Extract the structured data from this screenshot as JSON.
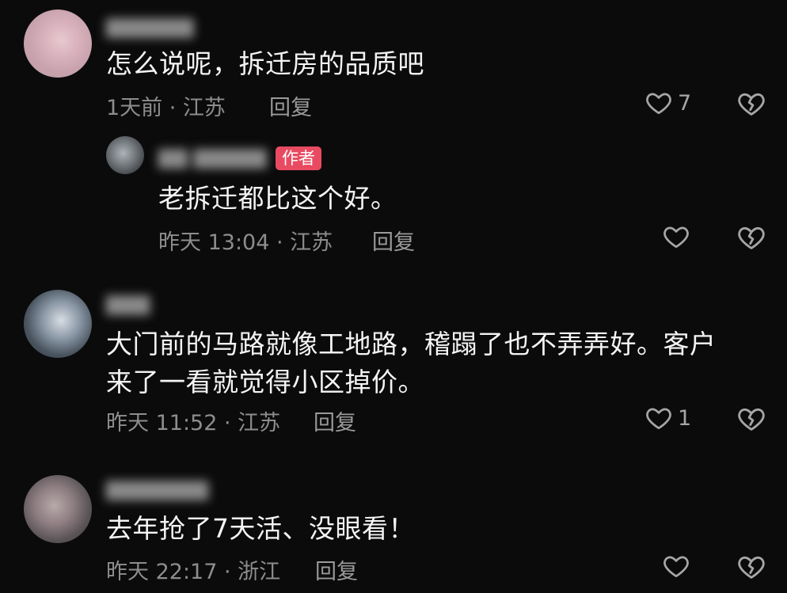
{
  "comments": [
    {
      "content": "怎么说呢，拆迁房的品质吧",
      "meta": "1天前 · 江苏",
      "reply": "回复",
      "likes": "7"
    },
    {
      "author_badge": "作者",
      "content": "老拆迁都比这个好。",
      "meta": "昨天 13:04 · 江苏",
      "reply": "回复",
      "likes": ""
    },
    {
      "content_line1": "大门前的马路就像工地路，稽蹋了也不弄弄好。客户",
      "content_line2": "来了一看就觉得小区掉价。",
      "meta": "昨天 11:52 · 江苏",
      "reply": "回复",
      "likes": "1"
    },
    {
      "content": "去年抢了7天活、没眼看！",
      "meta": "昨天 22:17 · 浙江",
      "reply": "回复",
      "likes": ""
    }
  ],
  "icons": {
    "like": "heart-outline-icon",
    "dislike": "broken-heart-icon"
  },
  "colors": {
    "background": "#0b0b0c",
    "author_badge": "#e84b61",
    "meta_text": "#8d8d8d"
  }
}
